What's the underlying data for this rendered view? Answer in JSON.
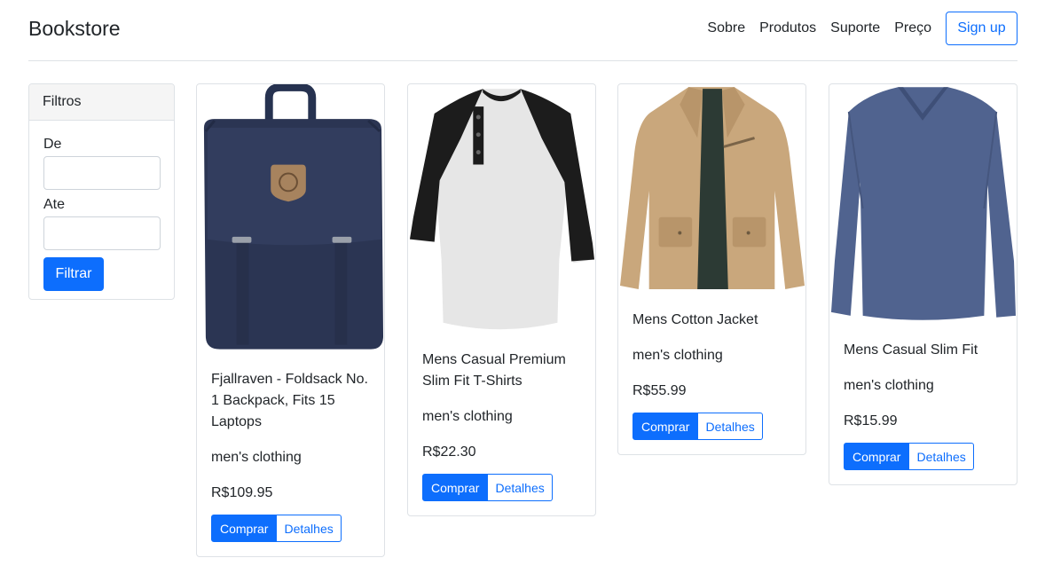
{
  "header": {
    "brand": "Bookstore",
    "nav": [
      "Sobre",
      "Produtos",
      "Suporte",
      "Preço"
    ],
    "signup": "Sign up"
  },
  "filters": {
    "title": "Filtros",
    "from_label": "De",
    "from_value": "",
    "to_label": "Ate",
    "to_value": "",
    "button": "Filtrar"
  },
  "colors": {
    "primary": "#0d6efd",
    "border": "#dee2e6",
    "text": "#212529"
  },
  "products": [
    {
      "title": "Fjallraven - Foldsack No. 1 Backpack, Fits 15 Laptops",
      "category": "men's clothing",
      "price": "R$109.95",
      "buy": "Comprar",
      "details": "Detalhes",
      "image": "backpack"
    },
    {
      "title": "Mens Casual Premium Slim Fit T-Shirts",
      "category": "men's clothing",
      "price": "R$22.30",
      "buy": "Comprar",
      "details": "Detalhes",
      "image": "raglan-tshirt"
    },
    {
      "title": "Mens Cotton Jacket",
      "category": "men's clothing",
      "price": "R$55.99",
      "buy": "Comprar",
      "details": "Detalhes",
      "image": "jacket"
    },
    {
      "title": "Mens Casual Slim Fit",
      "category": "men's clothing",
      "price": "R$15.99",
      "buy": "Comprar",
      "details": "Detalhes",
      "image": "long-sleeve-shirt"
    }
  ]
}
